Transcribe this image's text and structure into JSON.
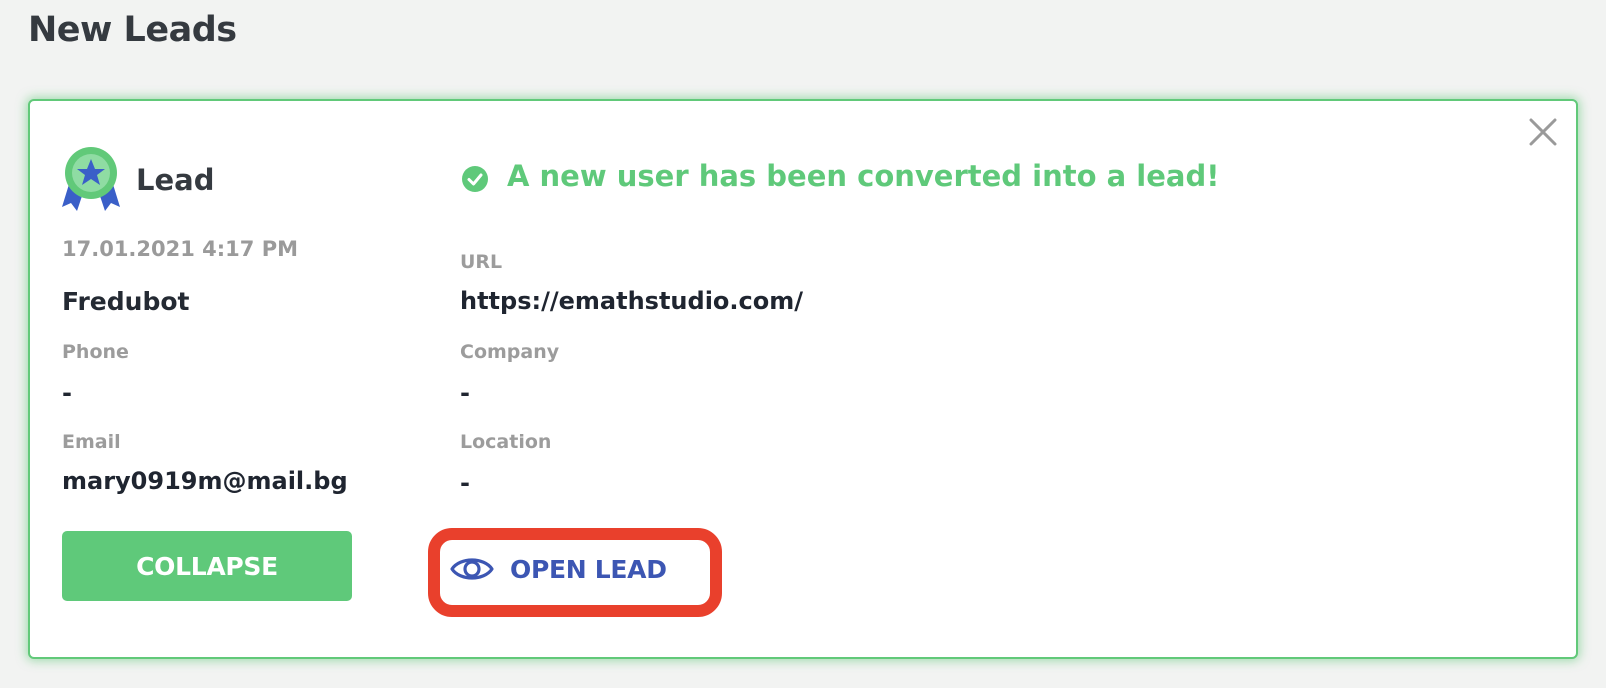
{
  "page": {
    "title": "New Leads"
  },
  "lead": {
    "type_label": "Lead",
    "date": "17.01.2021 4:17 PM",
    "name": "Fredubot",
    "phone_label": "Phone",
    "phone_value": "-",
    "email_label": "Email",
    "email_value": "mary0919m@mail.bg",
    "success_message": "A new user has been converted into a lead!",
    "url_label": "URL",
    "url_value": "https://emathstudio.com/",
    "company_label": "Company",
    "company_value": "-",
    "location_label": "Location",
    "location_value": "-"
  },
  "actions": {
    "collapse_label": "COLLAPSE",
    "open_label": "OPEN LEAD"
  },
  "icons": {
    "badge": "award-badge-icon",
    "success": "check-circle-icon",
    "open": "eye-icon",
    "close": "close-icon"
  },
  "colors": {
    "accent_green": "#5fc97a",
    "link_blue": "#3c56b3",
    "highlight_red": "#e9402c",
    "badge_blue": "#3a5fc8"
  }
}
